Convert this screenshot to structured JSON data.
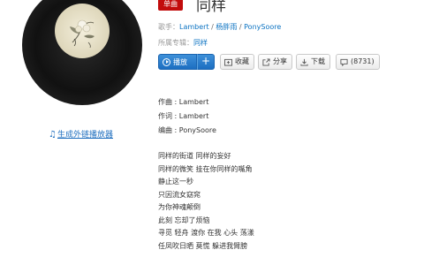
{
  "song": {
    "badge": "单曲",
    "title": "同样"
  },
  "meta": {
    "singer_label": "歌手：",
    "artists": [
      "Lambert",
      "杨胖雨",
      "PonySoore"
    ],
    "album_label": "所属专辑：",
    "album": "同样"
  },
  "actions": {
    "play": "播放",
    "add": "+",
    "collect": "收藏",
    "share": "分享",
    "download": "下载",
    "comments": "(8731)"
  },
  "player_link": "生成外链播放器",
  "credits": {
    "composer": "作曲 : Lambert",
    "lyricist": "作词 : Lambert",
    "arranger": "编曲 : PonySoore"
  },
  "lyrics": [
    "同样的街道 同样的妄好",
    "同样的微笑 挂在你同样的嘴角",
    "静止这一秒",
    "只因流女窈窕",
    "为你神魂颠倒",
    "此刻 忘却了烦恼",
    "寻觅 轻舟 渡你 在我 心头 荡漾",
    "任凤吹日晒 莫慌 躲进我臂膀"
  ],
  "icons": {
    "note": "music-note-icon",
    "play": "play-circle-icon",
    "collect": "folder-add-icon",
    "share": "share-icon",
    "download": "download-icon",
    "comment": "comment-icon"
  },
  "colors": {
    "badge": "#c20c0c",
    "link": "#0c73c2",
    "play_button": "#2b7fd0"
  }
}
